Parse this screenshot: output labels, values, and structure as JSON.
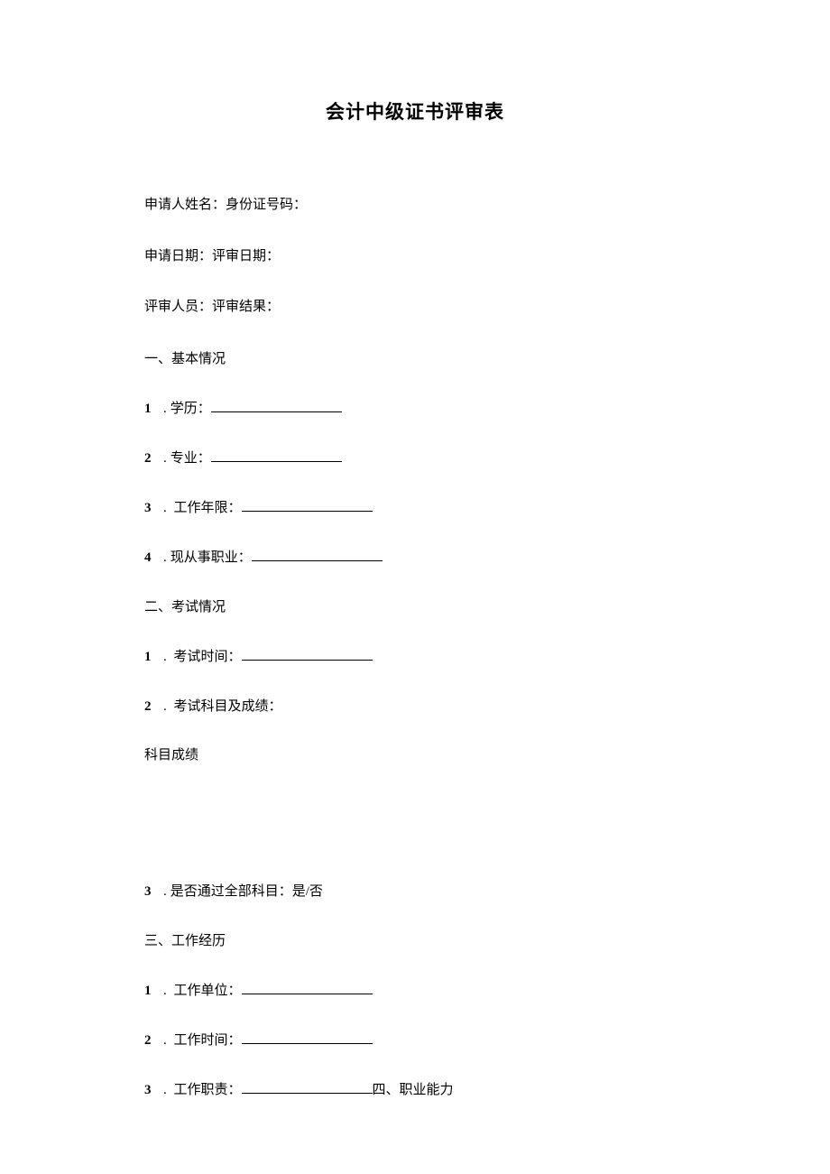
{
  "title": "会计中级证书评审表",
  "header_lines": {
    "line1": "申请人姓名：身份证号码：",
    "line2": "申请日期：评审日期：",
    "line3": "评审人员：评审结果："
  },
  "section1": {
    "heading": "一、基本情况",
    "items": [
      {
        "num": "1",
        "dot": ".",
        "label": "学历："
      },
      {
        "num": "2",
        "dot": ".",
        "label": "专业："
      },
      {
        "num": "3",
        "dot": ".",
        "label": " 工作年限："
      },
      {
        "num": "4",
        "dot": ".",
        "label": "现从事职业："
      }
    ]
  },
  "section2": {
    "heading": "二、考试情况",
    "items_a": [
      {
        "num": "1",
        "dot": ".",
        "label": " 考试时间："
      },
      {
        "num": "2",
        "dot": ".",
        "label": " 考试科目及成绩："
      }
    ],
    "subject_score": "科目成绩",
    "items_b": [
      {
        "num": "3",
        "dot": ".",
        "label": "是否通过全部科目：是/否"
      }
    ]
  },
  "section3": {
    "heading": "三、工作经历",
    "items": [
      {
        "num": "1",
        "dot": ".",
        "label": " 工作单位："
      },
      {
        "num": "2",
        "dot": ".",
        "label": " 工作时间："
      },
      {
        "num": "3",
        "dot": ".",
        "label": " 工作职责：",
        "trailing": "四、职业能力"
      }
    ]
  }
}
